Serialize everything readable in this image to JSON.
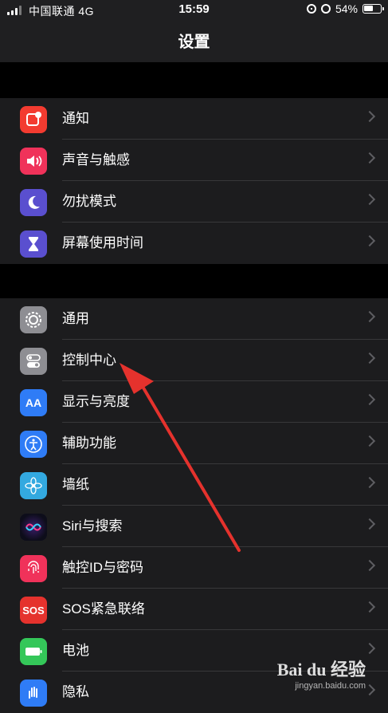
{
  "status_bar": {
    "carrier": "中国联通 4G",
    "time": "15:59",
    "battery": "54%"
  },
  "header": {
    "title": "设置"
  },
  "groups": [
    {
      "items": [
        {
          "label": "通知",
          "icon": "notification-icon",
          "color": "#f33b30"
        },
        {
          "label": "声音与触感",
          "icon": "sound-icon",
          "color": "#f0325a"
        },
        {
          "label": "勿扰模式",
          "icon": "moon-icon",
          "color": "#5a4fcf"
        },
        {
          "label": "屏幕使用时间",
          "icon": "hourglass-icon",
          "color": "#5a4fcf"
        }
      ]
    },
    {
      "items": [
        {
          "label": "通用",
          "icon": "gear-icon",
          "color": "#8e8e93"
        },
        {
          "label": "控制中心",
          "icon": "toggles-icon",
          "color": "#8e8e93"
        },
        {
          "label": "显示与亮度",
          "icon": "text-size-icon",
          "color": "#2f7cf6",
          "glyph": "AA"
        },
        {
          "label": "辅助功能",
          "icon": "accessibility-icon",
          "color": "#2f7cf6"
        },
        {
          "label": "墙纸",
          "icon": "wallpaper-flower-icon",
          "color": "#33a9e0"
        },
        {
          "label": "Siri与搜索",
          "icon": "siri-icon",
          "color": "#1a1a2e"
        },
        {
          "label": "触控ID与密码",
          "icon": "fingerprint-icon",
          "color": "#f0325a"
        },
        {
          "label": "SOS紧急联络",
          "icon": "sos-icon",
          "color": "#e5322d",
          "glyph": "SOS"
        },
        {
          "label": "电池",
          "icon": "battery-icon",
          "color": "#34c759"
        },
        {
          "label": "隐私",
          "icon": "privacy-hand-icon",
          "color": "#2f7cf6"
        }
      ]
    }
  ],
  "watermark": {
    "brand": "Bai du 经验",
    "sub": "jingyan.baidu.com"
  },
  "annotation": {
    "arrow_color": "#e5322d"
  }
}
